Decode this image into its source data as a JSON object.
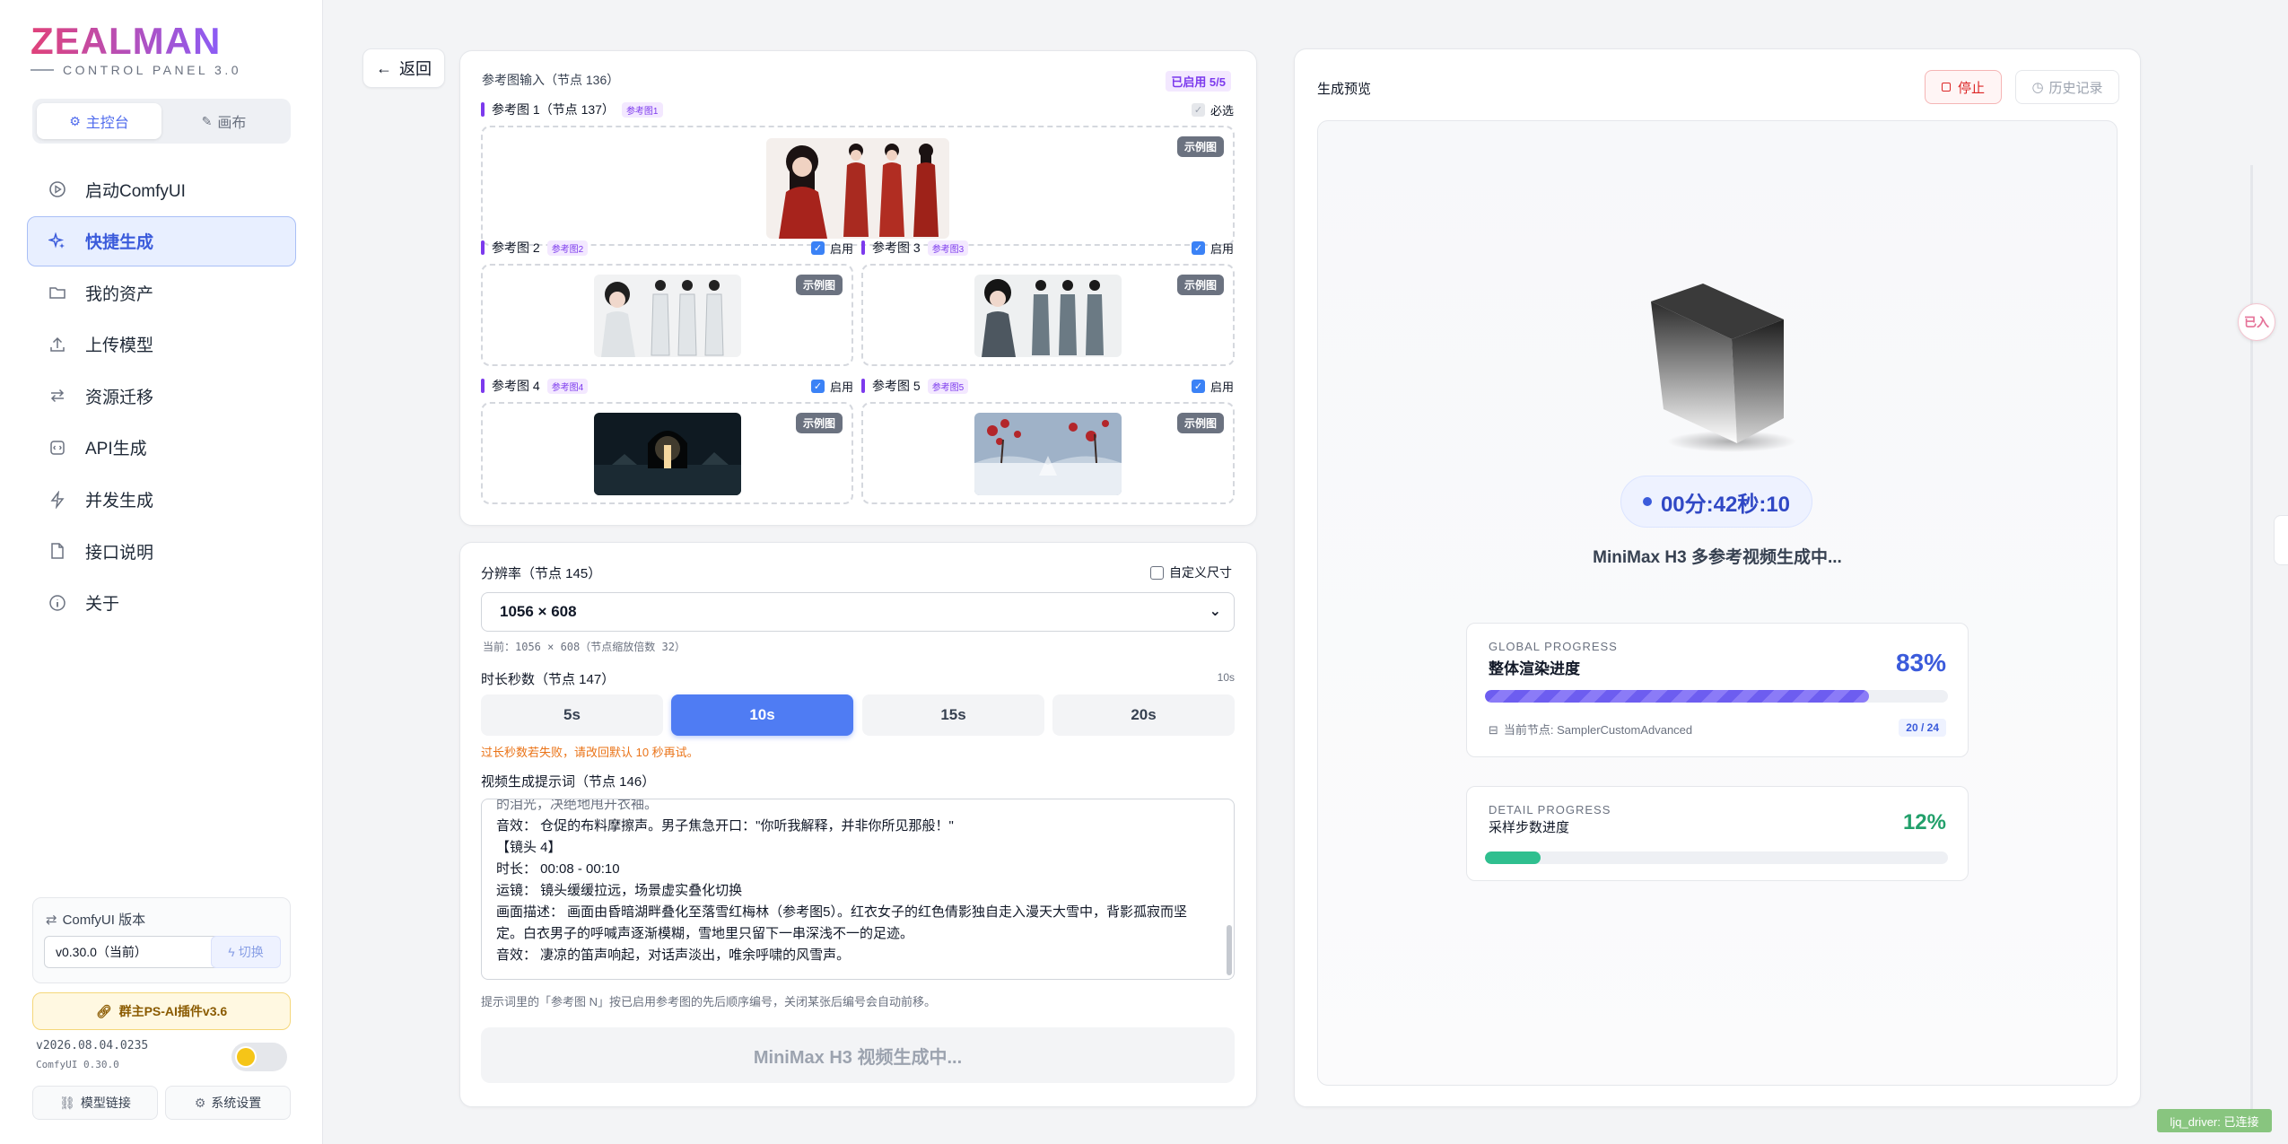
{
  "sidebar": {
    "logo": "ZEALMAN",
    "logo_sub": "CONTROL PANEL 3.0",
    "tabs": [
      {
        "label": "主控台"
      },
      {
        "label": "画布"
      }
    ],
    "items": [
      {
        "label": "启动ComfyUI",
        "icon": "play-circle-icon"
      },
      {
        "label": "快捷生成",
        "icon": "sparkles-icon"
      },
      {
        "label": "我的资产",
        "icon": "folder-icon"
      },
      {
        "label": "上传模型",
        "icon": "upload-icon"
      },
      {
        "label": "资源迁移",
        "icon": "transfer-icon"
      },
      {
        "label": "API生成",
        "icon": "api-icon"
      },
      {
        "label": "并发生成",
        "icon": "lightning-icon"
      },
      {
        "label": "接口说明",
        "icon": "document-icon"
      },
      {
        "label": "关于",
        "icon": "info-icon"
      }
    ],
    "comfy_version_title": "ComfyUI 版本",
    "comfy_version_value": "v0.30.0（当前）",
    "switch_label": "切换",
    "plugin_label": "群主PS-AI插件v3.6",
    "build_version": "v2026.08.04.0235",
    "build_comfy": "ComfyUI 0.30.0",
    "footer_links": [
      "模型链接",
      "系统设置"
    ]
  },
  "back_label": "返回",
  "ref": {
    "title": "参考图输入（节点 136）",
    "enabled_badge": "已启用 5/5",
    "required_label": "必选",
    "demo_label": "示例图",
    "enable_label": "启用",
    "images": [
      {
        "label": "参考图 1（节点 137）",
        "tag": "参考图1"
      },
      {
        "label": "参考图 2",
        "tag": "参考图2"
      },
      {
        "label": "参考图 3",
        "tag": "参考图3"
      },
      {
        "label": "参考图 4",
        "tag": "参考图4"
      },
      {
        "label": "参考图 5",
        "tag": "参考图5"
      }
    ]
  },
  "settings": {
    "resolution_label": "分辨率（节点 145）",
    "custom_size_label": "自定义尺寸",
    "resolution_value": "1056 × 608",
    "resolution_hint": "当前：1056 × 608（节点缩放倍数 32）",
    "duration_label": "时长秒数（节点 147）",
    "duration_current": "10s",
    "durations": [
      "5s",
      "10s",
      "15s",
      "20s"
    ],
    "duration_warning": "过长秒数若失败，请改回默认 10 秒再试。",
    "prompt_label": "视频生成提示词（节点 146）",
    "prompt_lines": [
      "的泪光，决绝地甩开衣袖。",
      "音效： 仓促的布料摩擦声。男子焦急开口：\"你听我解释，并非你所见那般！\"",
      "【镜头 4】",
      "时长： 00:08 - 00:10",
      "运镜： 镜头缓缓拉远，场景虚实叠化切换",
      "画面描述： 画面由昏暗湖畔叠化至落雪红梅林（参考图5）。红衣女子的红色倩影独自走入漫天大雪中，背影孤寂而坚",
      "定。白衣男子的呼喊声逐渐模糊，雪地里只留下一串深浅不一的足迹。",
      "音效： 凄凉的笛声响起，对话声淡出，唯余呼啸的风雪声。"
    ],
    "prompt_hint": "提示词里的「参考图 N」按已启用参考图的先后顺序编号，关闭某张后编号会自动前移。",
    "generate_label": "MiniMax H3 视频生成中..."
  },
  "preview": {
    "title": "生成预览",
    "stop_label": "停止",
    "history_label": "历史记录",
    "timer": "00分:42秒:10",
    "status": "MiniMax H3 多参考视频生成中...",
    "global": {
      "kicker": "GLOBAL PROGRESS",
      "title": "整体渲染进度",
      "percent": "83%",
      "value": 0.83,
      "node_label": "当前节点: SamplerCustomAdvanced",
      "steps": "20 / 24"
    },
    "detail": {
      "kicker": "DETAIL PROGRESS",
      "title": "采样步数进度",
      "percent": "12%",
      "value": 0.12
    }
  },
  "edge_badge": "已入",
  "connection": "ljq_driver: 已连接",
  "colors": {
    "accent": "#4f7cf3",
    "global_fill": "#7b6cf6",
    "detail_fill": "#2fbf8f",
    "percent_global": "#3b5bdb",
    "percent_detail": "#22a06b"
  }
}
